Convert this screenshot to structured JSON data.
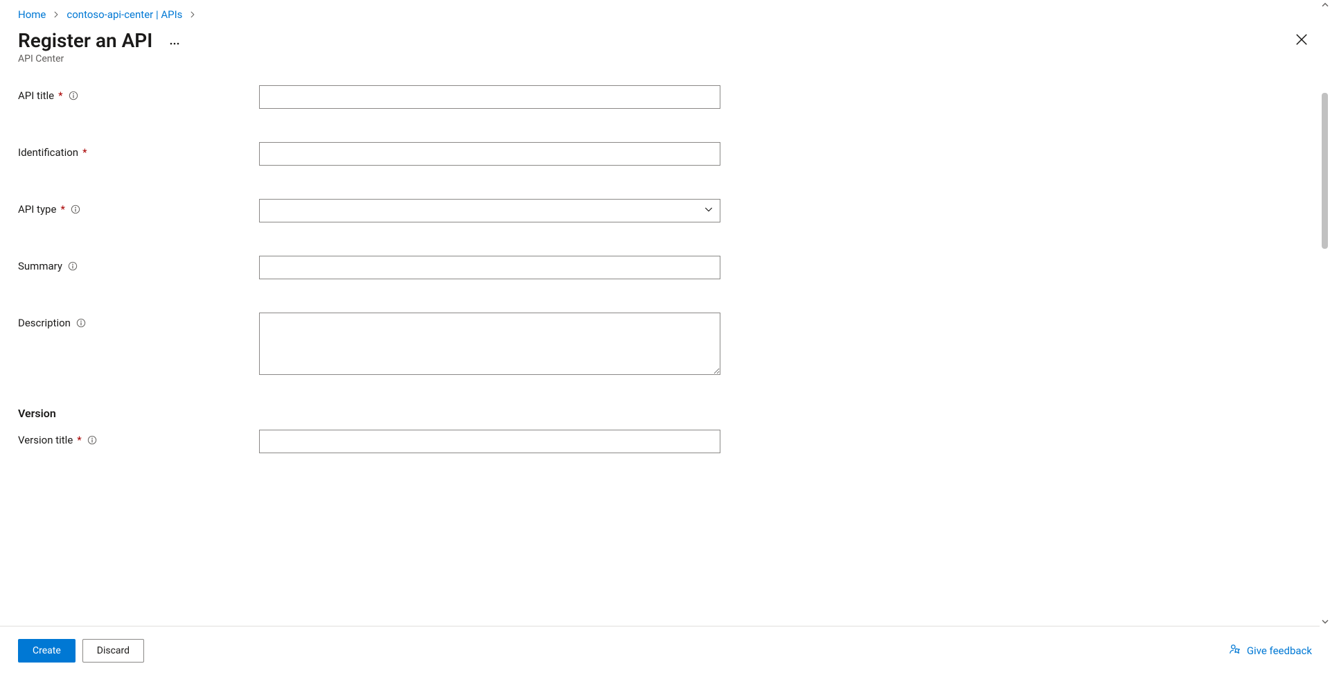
{
  "breadcrumb": {
    "home": "Home",
    "center": "contoso-api-center | APIs"
  },
  "header": {
    "title": "Register an API",
    "subtitle": "API Center"
  },
  "form": {
    "apiTitle": {
      "label": "API title",
      "required": true,
      "info": true,
      "value": ""
    },
    "identification": {
      "label": "Identification",
      "required": true,
      "info": false,
      "value": ""
    },
    "apiType": {
      "label": "API type",
      "required": true,
      "info": true,
      "value": ""
    },
    "summary": {
      "label": "Summary",
      "required": false,
      "info": true,
      "value": ""
    },
    "description": {
      "label": "Description",
      "required": false,
      "info": true,
      "value": ""
    },
    "versionSection": "Version",
    "versionTitle": {
      "label": "Version title",
      "required": true,
      "info": true,
      "value": ""
    }
  },
  "footer": {
    "create": "Create",
    "discard": "Discard",
    "feedback": "Give feedback"
  }
}
